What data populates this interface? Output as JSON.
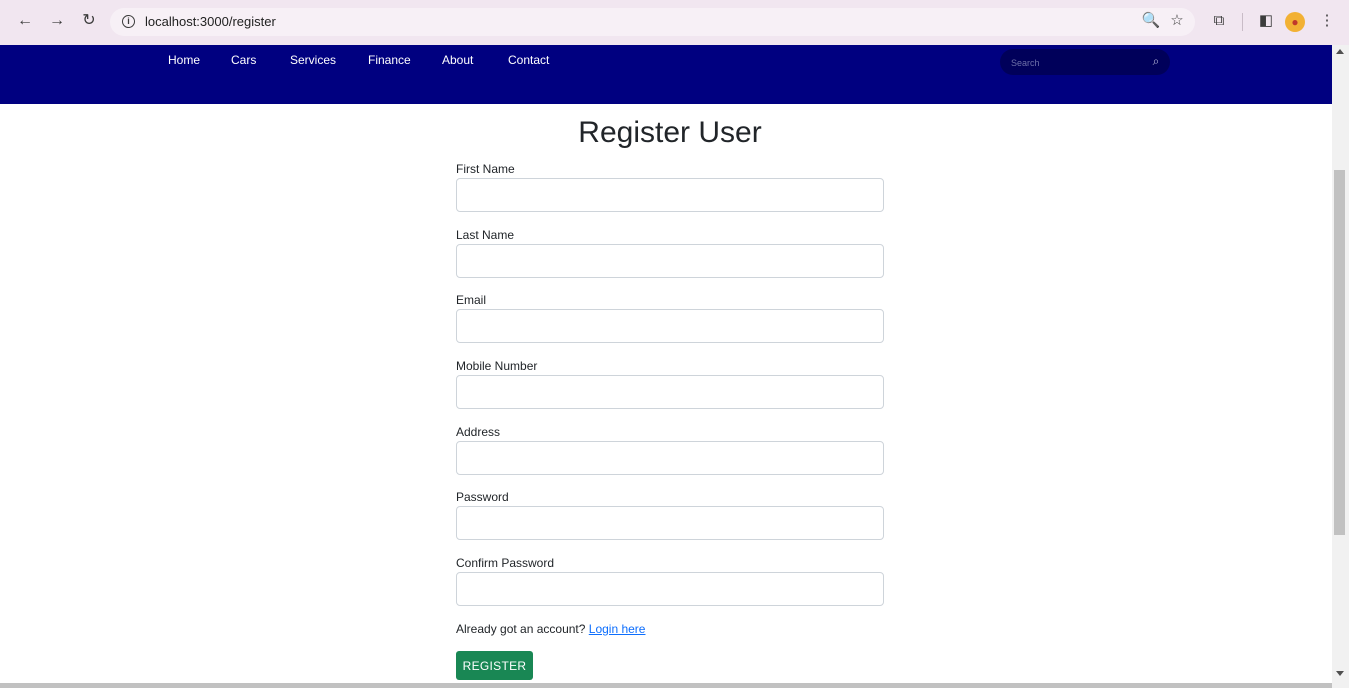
{
  "browser": {
    "url": "localhost:3000/register",
    "back_glyph": "←",
    "forward_glyph": "→",
    "reload_glyph": "↻",
    "info_glyph": "i",
    "zoom_glyph": "🔍",
    "star_glyph": "☆",
    "extensions_glyph": "⧉",
    "sidepanel_glyph": "◧",
    "menu_glyph": "⋮"
  },
  "navbar": {
    "links": [
      "Home",
      "Cars",
      "Services",
      "Finance",
      "About",
      "Contact"
    ],
    "search_placeholder": "Search",
    "search_glyph": "⌕",
    "background": "#000080"
  },
  "form": {
    "title": "Register User",
    "fields": [
      {
        "label": "First Name",
        "value": ""
      },
      {
        "label": "Last Name",
        "value": ""
      },
      {
        "label": "Email",
        "value": ""
      },
      {
        "label": "Mobile Number",
        "value": ""
      },
      {
        "label": "Address",
        "value": ""
      },
      {
        "label": "Password",
        "value": ""
      },
      {
        "label": "Confirm Password",
        "value": ""
      }
    ],
    "account_prompt": "Already got an account?",
    "login_link": "Login here",
    "submit_label": "REGISTER",
    "submit_color": "#198754"
  }
}
